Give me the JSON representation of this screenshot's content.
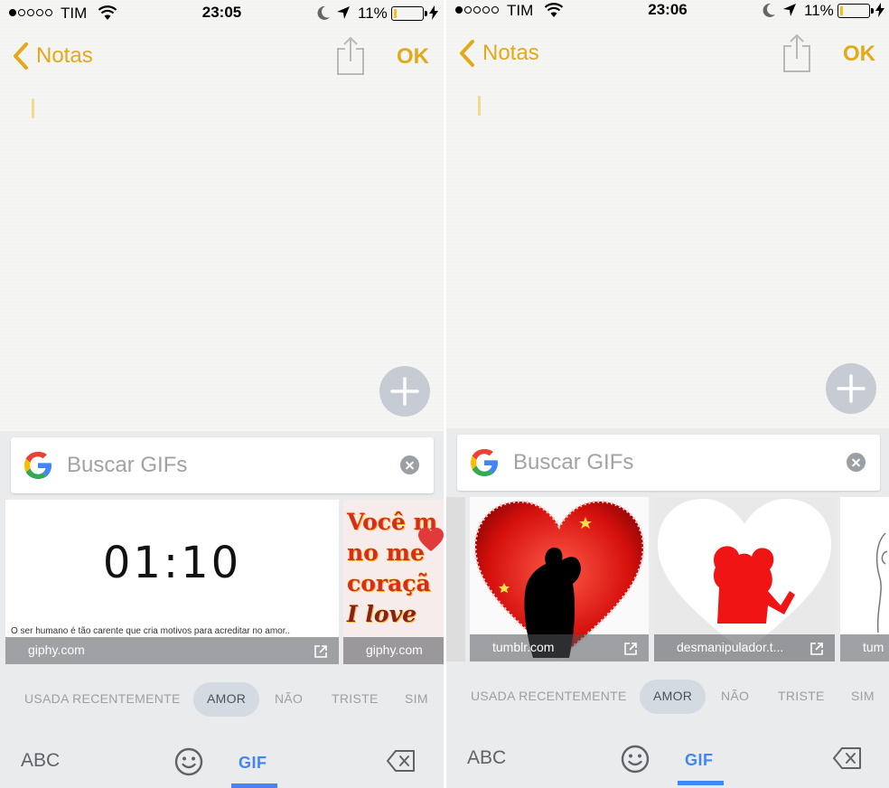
{
  "colors": {
    "accent": "#e3a91b",
    "google_blue": "#4285f4",
    "battery": "#f0c21a"
  },
  "screens": [
    {
      "status": {
        "carrier": "TIM",
        "time": "23:05",
        "battery": "11%",
        "battery_level": 0.11
      },
      "nav": {
        "back_label": "Notas",
        "done_label": "OK"
      },
      "search": {
        "placeholder": "Buscar GIFs"
      },
      "gifs": [
        {
          "counter": "01:10",
          "caption": "O ser humano é tão carente que cria motivos para acreditar no amor..",
          "source": "giphy.com"
        },
        {
          "text_lines": [
            "Você m",
            "no me",
            "coraçã",
            "I love"
          ],
          "source": "giphy.com"
        }
      ],
      "tabs": [
        "USADA RECENTEMENTE",
        "AMOR",
        "NÃO",
        "TRISTE",
        "SIM"
      ],
      "bottom": {
        "abc": "ABC",
        "gif": "GIF"
      }
    },
    {
      "status": {
        "carrier": "TIM",
        "time": "23:06",
        "battery": "11%",
        "battery_level": 0.11
      },
      "nav": {
        "back_label": "Notas",
        "done_label": "OK"
      },
      "search": {
        "placeholder": "Buscar GIFs"
      },
      "gifs": [
        {
          "source": "tumblr.com"
        },
        {
          "source": "desmanipulador.t..."
        },
        {
          "source": "tum"
        }
      ],
      "tabs": [
        "USADA RECENTEMENTE",
        "AMOR",
        "NÃO",
        "TRISTE",
        "SIM"
      ],
      "bottom": {
        "abc": "ABC",
        "gif": "GIF"
      }
    }
  ]
}
